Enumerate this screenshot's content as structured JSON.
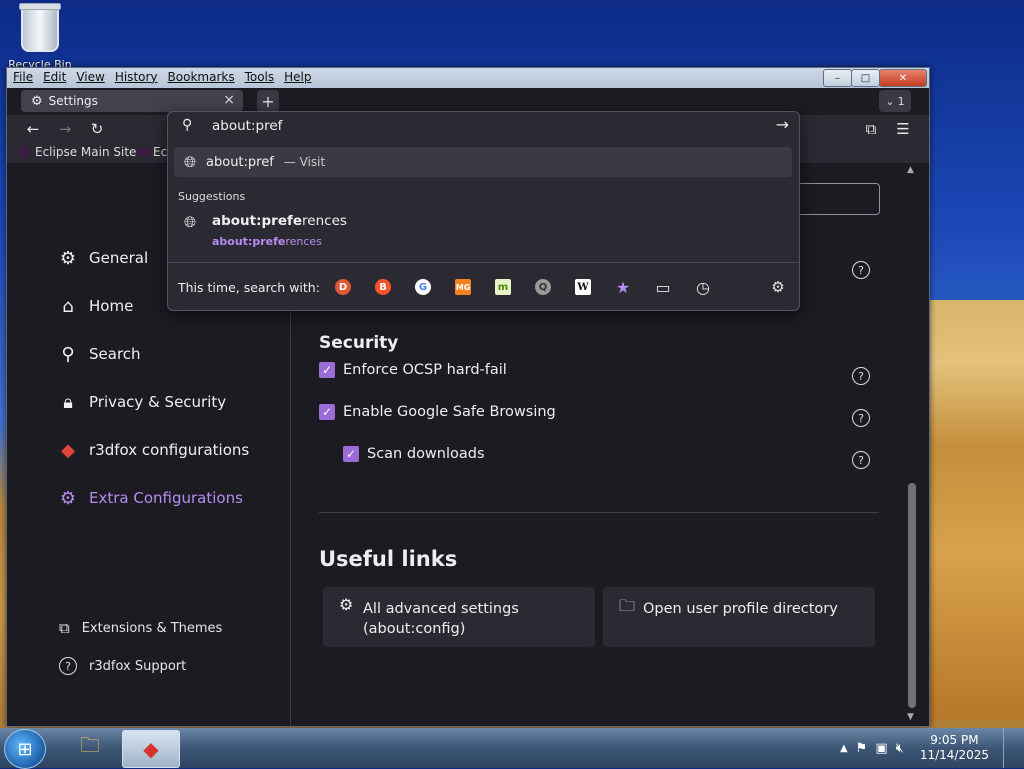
{
  "desktop": {
    "recycle_bin_label": "Recycle Bin"
  },
  "menubar": [
    "File",
    "Edit",
    "View",
    "History",
    "Bookmarks",
    "Tools",
    "Help"
  ],
  "window_controls": {
    "minimize": "–",
    "maximize": "□",
    "close": "✕"
  },
  "tab": {
    "title": "Settings",
    "close": "×"
  },
  "new_tab": "+",
  "tab_list": {
    "label": "1"
  },
  "bookmarks": [
    "Eclipse Main Site",
    "Ec"
  ],
  "urlbar": {
    "value": "about:pref"
  },
  "dropdown": {
    "visit": {
      "url": "about:pref",
      "suffix": "— Visit"
    },
    "suggestions_header": "Suggestions",
    "suggestion": {
      "title_bold": "about:prefe",
      "title_rest": "rences",
      "url_bold": "about:prefe",
      "url_rest": "rences"
    },
    "search_with_label": "This time, search with:",
    "engines": [
      {
        "name": "duckduckgo-icon",
        "color": "#de5833",
        "glyph": "D"
      },
      {
        "name": "brave-icon",
        "color": "#fb542b",
        "glyph": "B"
      },
      {
        "name": "google-icon",
        "color": "#4285f4",
        "glyph": "G"
      },
      {
        "name": "mojeek-icon",
        "color": "#f58220",
        "glyph": "MG"
      },
      {
        "name": "marginalia-icon",
        "color": "#7bb31a",
        "glyph": "m"
      },
      {
        "name": "searx-icon",
        "color": "#9a9a9a",
        "glyph": "Q"
      },
      {
        "name": "wikipedia-icon",
        "color": "#ffffff",
        "glyph": "W"
      },
      {
        "name": "bookmarks-star-icon",
        "color": "#b58cf0",
        "glyph": "★"
      },
      {
        "name": "tabs-icon",
        "color": "#e6e6e6",
        "glyph": "▭"
      },
      {
        "name": "history-icon",
        "color": "#e6e6e6",
        "glyph": "◷"
      }
    ]
  },
  "sidebar": {
    "categories": [
      {
        "label": "General"
      },
      {
        "label": "Home"
      },
      {
        "label": "Search"
      },
      {
        "label": "Privacy & Security"
      },
      {
        "label": "r3dfox configurations"
      },
      {
        "label": "Extra Configurations"
      }
    ],
    "footer": [
      {
        "label": "Extensions & Themes"
      },
      {
        "label": "r3dfox Support"
      }
    ]
  },
  "security": {
    "title": "Security",
    "options": [
      {
        "label": "Enforce OCSP hard-fail",
        "checked": true
      },
      {
        "label": "Enable Google Safe Browsing",
        "checked": true
      },
      {
        "label": "Scan downloads",
        "checked": true
      }
    ]
  },
  "useful_links": {
    "title": "Useful links",
    "cards": [
      {
        "line1": "All advanced settings",
        "line2": "(about:config)"
      },
      {
        "line1": "Open user profile directory",
        "line2": ""
      }
    ]
  },
  "help_glyph": "?",
  "check_glyph": "✓",
  "taskbar": {
    "time": "9:05 PM",
    "date": "11/14/2025"
  },
  "colors": {
    "accent": "#b58cf0",
    "checkbox": "#9b6bd8",
    "page_bg": "#1c1b22"
  }
}
